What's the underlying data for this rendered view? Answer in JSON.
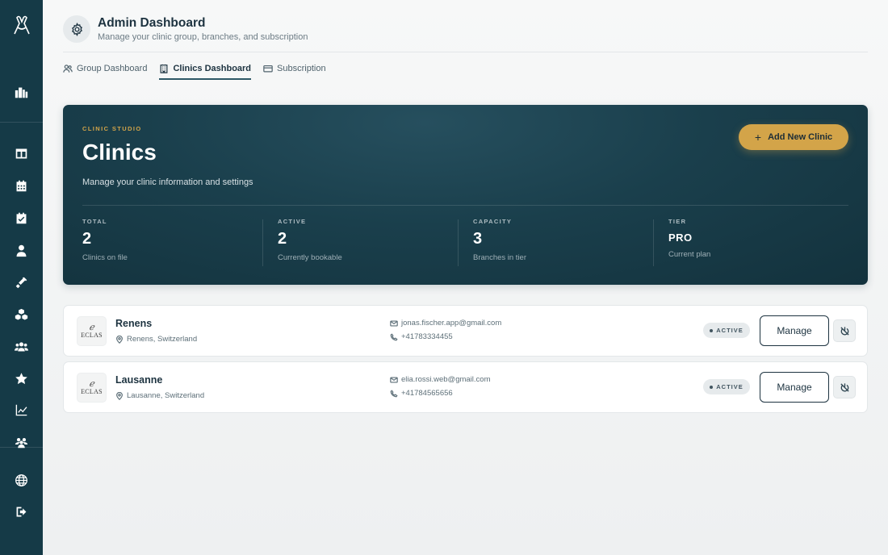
{
  "header": {
    "title": "Admin Dashboard",
    "subtitle": "Manage your clinic group, branches, and subscription"
  },
  "tabs": [
    {
      "label": "Group Dashboard",
      "icon": "users-icon",
      "active": false
    },
    {
      "label": "Clinics Dashboard",
      "icon": "building-icon",
      "active": true
    },
    {
      "label": "Subscription",
      "icon": "credit-card-icon",
      "active": false
    }
  ],
  "sidebar": {
    "items": [
      {
        "icon": "logo-icon"
      },
      {
        "icon": "city-icon"
      },
      {
        "icon": "table-icon"
      },
      {
        "icon": "calendar-icon"
      },
      {
        "icon": "calendar-check-icon"
      },
      {
        "icon": "doctor-icon"
      },
      {
        "icon": "syringe-icon"
      },
      {
        "icon": "cubes-icon"
      },
      {
        "icon": "users-group-icon"
      },
      {
        "icon": "star-icon"
      },
      {
        "icon": "chart-line-icon"
      },
      {
        "icon": "team-icon"
      },
      {
        "icon": "globe-icon"
      },
      {
        "icon": "logout-icon"
      }
    ]
  },
  "hero": {
    "eyebrow": "CLINIC STUDIO",
    "title": "Clinics",
    "description": "Manage your clinic information and settings",
    "add_button": "Add New Clinic",
    "accent": "#d3a449",
    "stats": [
      {
        "label": "TOTAL",
        "value": "2",
        "note": "Clinics on file"
      },
      {
        "label": "ACTIVE",
        "value": "2",
        "note": "Currently bookable"
      },
      {
        "label": "CAPACITY",
        "value": "3",
        "note": "Branches in tier"
      },
      {
        "label": "TIER",
        "value": "PRO",
        "note": "Current plan"
      }
    ]
  },
  "clinics": [
    {
      "name": "Renens",
      "location": "Renens, Switzerland",
      "email": "jonas.fischer.app@gmail.com",
      "phone": "+41783334455",
      "status": "ACTIVE",
      "logo_text": "ECLAS",
      "manage_label": "Manage"
    },
    {
      "name": "Lausanne",
      "location": "Lausanne, Switzerland",
      "email": "elia.rossi.web@gmail.com",
      "phone": "+41784565656",
      "status": "ACTIVE",
      "logo_text": "ECLAS",
      "manage_label": "Manage"
    }
  ]
}
